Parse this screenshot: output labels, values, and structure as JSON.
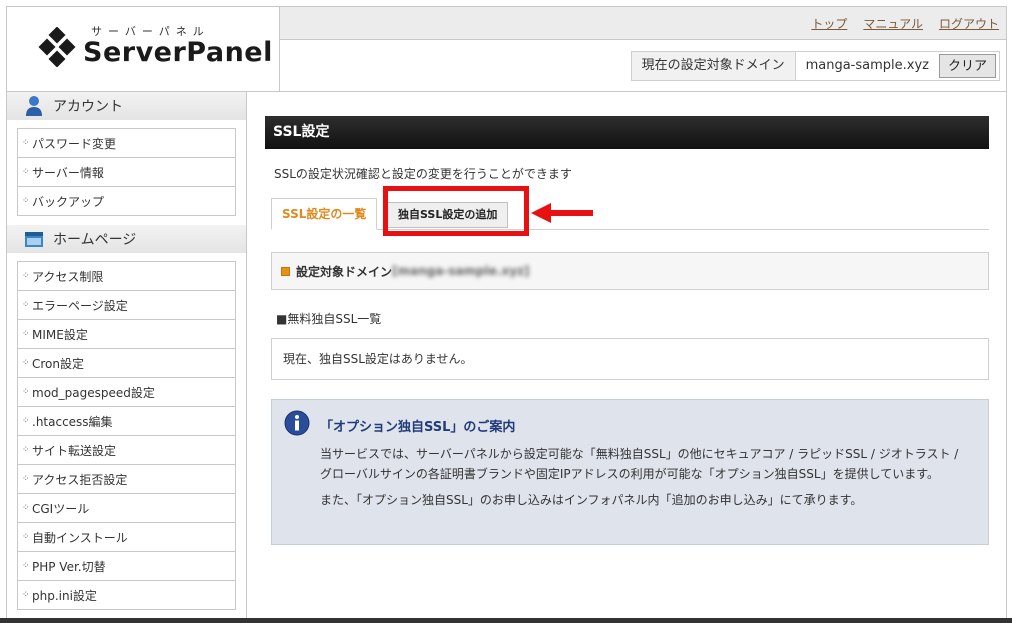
{
  "logo": {
    "subtitle": "サーバーパネル",
    "title": "ServerPanel"
  },
  "header": {
    "links": [
      "トップ",
      "マニュアル",
      "ログアウト"
    ],
    "domain_label": "現在の設定対象ドメイン",
    "domain_value": "manga-sample.xyz",
    "clear_label": "クリア"
  },
  "sidebar": {
    "account": {
      "heading": "アカウント",
      "items": [
        "パスワード変更",
        "サーバー情報",
        "バックアップ"
      ]
    },
    "homepage": {
      "heading": "ホームページ",
      "items": [
        "アクセス制限",
        "エラーページ設定",
        "MIME設定",
        "Cron設定",
        "mod_pagespeed設定",
        ".htaccess編集",
        "サイト転送設定",
        "アクセス拒否設定",
        "CGIツール",
        "自動インストール",
        "PHP Ver.切替",
        "php.ini設定"
      ]
    }
  },
  "main": {
    "title": "SSL設定",
    "description": "SSLの設定状況確認と設定の変更を行うことができます",
    "tabs": {
      "list": "SSL設定の一覧",
      "add": "独自SSL設定の追加"
    },
    "domain_panel_label": "設定対象ドメイン",
    "domain_panel_value": "[manga-sample.xyz]",
    "section_title": "■無料独自SSL一覧",
    "empty_message": "現在、独自SSL設定はありません。",
    "info": {
      "title": "「オプション独自SSL」のご案内",
      "paragraph1": "当サービスでは、サーバーパネルから設定可能な「無料独自SSL」の他にセキュアコア / ラピッドSSL / ジオトラスト / グローバルサインの各証明書ブランドや固定IPアドレスの利用が可能な「オプション独自SSL」を提供しています。",
      "paragraph2": "また、「オプション独自SSL」のお申し込みはインフォパネル内「追加のお申し込み」にて承ります。"
    }
  },
  "colors": {
    "accent": "#e08a1e",
    "highlight": "#e81010",
    "info_title": "#203b7a"
  }
}
